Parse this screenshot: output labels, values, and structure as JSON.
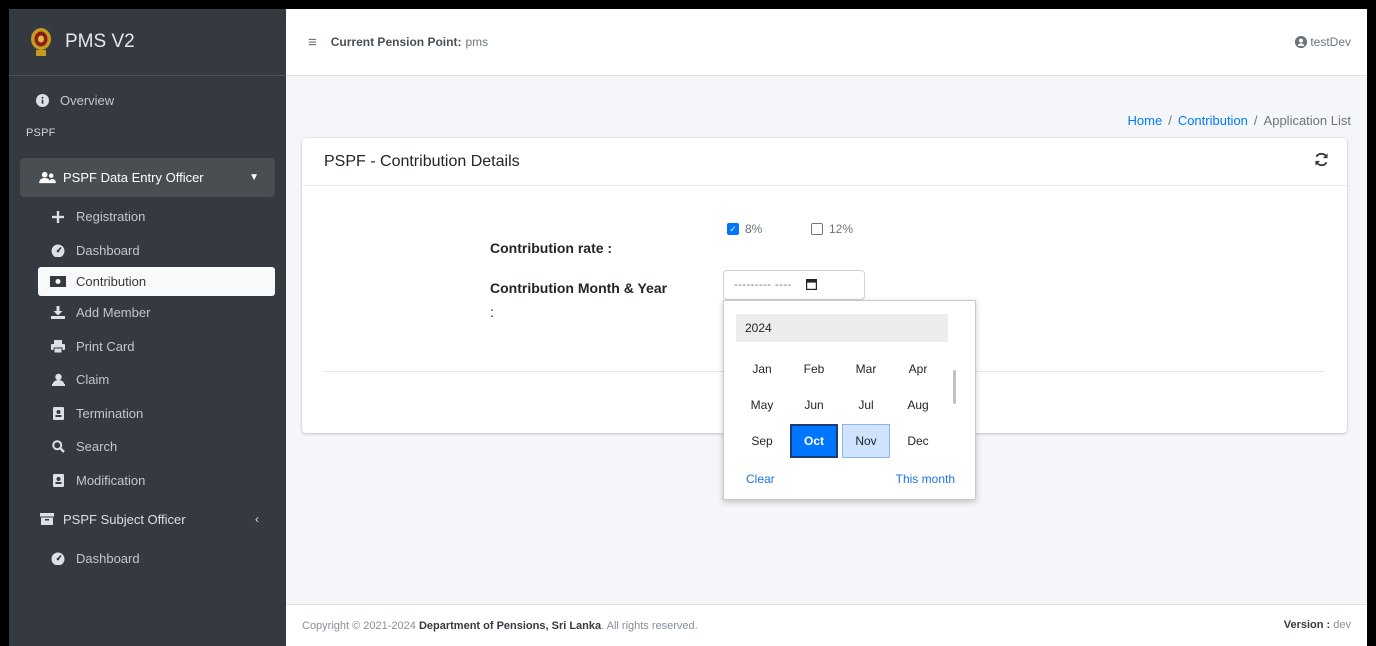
{
  "app": {
    "brand": "PMS V2"
  },
  "topbar": {
    "pension_point_label": "Current Pension Point:",
    "pension_point_value": "pms",
    "user": "testDev"
  },
  "sidebar": {
    "overview": "Overview",
    "section_header": "PSPF",
    "group1": {
      "label": "PSPF Data Entry Officer",
      "items": [
        {
          "label": "Registration",
          "icon": "plus-icon"
        },
        {
          "label": "Dashboard",
          "icon": "tachometer-icon"
        },
        {
          "label": "Contribution",
          "icon": "money-bill-icon",
          "active": true
        },
        {
          "label": "Add Member",
          "icon": "download-icon"
        },
        {
          "label": "Print Card",
          "icon": "print-icon"
        },
        {
          "label": "Claim",
          "icon": "id-badge-icon"
        },
        {
          "label": "Termination",
          "icon": "address-book-icon"
        },
        {
          "label": "Search",
          "icon": "search-icon"
        },
        {
          "label": "Modification",
          "icon": "address-book-icon"
        }
      ]
    },
    "group2": {
      "label": "PSPF Subject Officer",
      "items": [
        {
          "label": "Dashboard",
          "icon": "tachometer-icon"
        }
      ]
    }
  },
  "breadcrumb": {
    "home": "Home",
    "contribution": "Contribution",
    "current": "Application List",
    "separator": "/"
  },
  "card": {
    "title": "PSPF - Contribution Details",
    "rate_label": "Contribution rate :",
    "rate_options": [
      {
        "label": "8%",
        "checked": true
      },
      {
        "label": "12%",
        "checked": false
      }
    ],
    "month_label": "Contribution Month & Year",
    "month_label_colon": ":",
    "month_placeholder": "--------- ----"
  },
  "picker": {
    "year": "2024",
    "months": [
      "Jan",
      "Feb",
      "Mar",
      "Apr",
      "May",
      "Jun",
      "Jul",
      "Aug",
      "Sep",
      "Oct",
      "Nov",
      "Dec"
    ],
    "selected": "Oct",
    "hovered": "Nov",
    "clear": "Clear",
    "this_month": "This month"
  },
  "footer": {
    "copyright_prefix": "Copyright © 2021-2024",
    "org": "Department of Pensions, Sri Lanka",
    "suffix": ". All rights reserved.",
    "version_label": "Version :",
    "version_value": "dev"
  },
  "colors": {
    "sidebar": "#343a40",
    "primary": "#007bff",
    "selected_month": "#0075ff"
  }
}
